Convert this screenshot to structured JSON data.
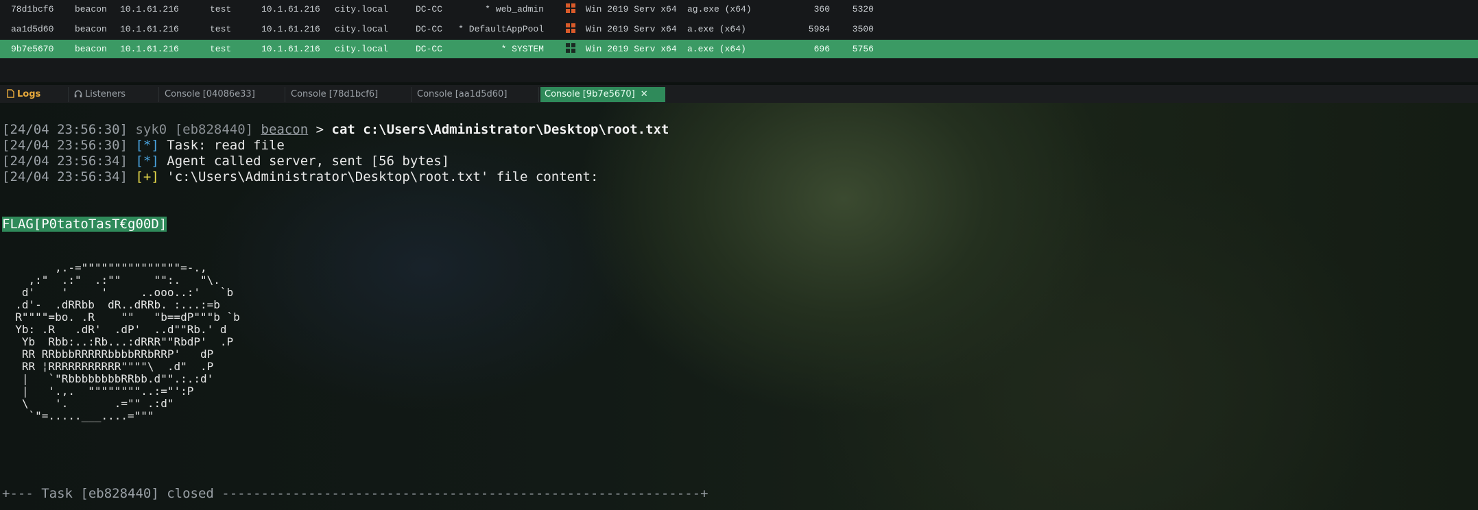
{
  "sessions": [
    {
      "id": "78d1bcf6",
      "type": "beacon",
      "ip": "10.1.61.216",
      "user1": "test",
      "ip2": "10.1.61.216",
      "domain": "city.local",
      "computer": "DC-CC",
      "user": "* web_admin",
      "os": "Win 2019 Serv x64",
      "process": "ag.exe (x64)",
      "pid": "360",
      "tid": "5320",
      "selected": false
    },
    {
      "id": "aa1d5d60",
      "type": "beacon",
      "ip": "10.1.61.216",
      "user1": "test",
      "ip2": "10.1.61.216",
      "domain": "city.local",
      "computer": "DC-CC",
      "user": "* DefaultAppPool",
      "os": "Win 2019 Serv x64",
      "process": "a.exe (x64)",
      "pid": "5984",
      "tid": "3500",
      "selected": false
    },
    {
      "id": "9b7e5670",
      "type": "beacon",
      "ip": "10.1.61.216",
      "user1": "test",
      "ip2": "10.1.61.216",
      "domain": "city.local",
      "computer": "DC-CC",
      "user": "* SYSTEM",
      "os": "Win 2019 Serv x64",
      "process": "a.exe (x64)",
      "pid": "696",
      "tid": "5756",
      "selected": true
    }
  ],
  "tabs": {
    "logs": "Logs",
    "listeners": "Listeners",
    "c1": "Console [04086e33]",
    "c2": "Console [78d1bcf6]",
    "c3": "Console [aa1d5d60]",
    "c4": "Console [9b7e5670]",
    "close": "✕"
  },
  "console": {
    "l1": {
      "ts": "[24/04 23:56:30]",
      "user": "syk0",
      "task": "[eb828440]",
      "agent": "beacon",
      "prompt": ">",
      "cmd": "cat c:\\Users\\Administrator\\Desktop\\root.txt"
    },
    "l2": {
      "ts": "[24/04 23:56:30]",
      "tag": "[*]",
      "text": "Task: read file"
    },
    "l3": {
      "ts": "[24/04 23:56:34]",
      "tag": "[*]",
      "text": "Agent called server, sent [56 bytes]"
    },
    "l4": {
      "ts": "[24/04 23:56:34]",
      "tag": "[+]",
      "text": "'c:\\Users\\Administrator\\Desktop\\root.txt' file content:"
    },
    "flag": "FLAG[P0tatoTasT€g00D]",
    "ascii": "        ,.-=\"\"\"\"\"\"\"\"\"\"\"\"\"\"\"=-.,\n    ,:\"  .:\"  .:\"\"     \"\":.   \"\\.\n   d'    '     '     ..ooo..:'   `b\n  .d'-  .dRRbb  dR..dRRb. :...:=b\n  R\"\"\"\"=bo. .R    \"\"   \"b==dP\"\"\"b `b\n  Yb: .R   .dR'  .dP'  ..d\"\"Rb.' d\n   Yb  Rbb:..:Rb...:dRRR\"\"RbdP'  .P\n   RR RRbbbRRRRRbbbbRRbRRP'   dP\n   RR ¦RRRRRRRRRRR\"\"\"\"\\  .d\"  .P\n   |   `\"RbbbbbbbbRRbb.d\"\".:.:d'\n   |   '.,.  \"\"\"\"\"\"\"\"..:=\"':P\n   \\    '.       .=\"\" .:d\"\n    `\"=.....___....=\"\"\"",
    "footer": "+--- Task [eb828440] closed -------------------------------------------------------------+"
  },
  "colors": {
    "accent": "#3b9a64",
    "info": "#4aa3df",
    "success": "#e6d84a",
    "logs": "#e6a93c"
  }
}
